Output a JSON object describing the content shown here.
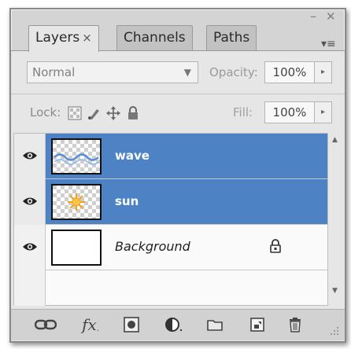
{
  "window": {
    "collapse_glyph": "–",
    "close_glyph": "✕"
  },
  "tabs": [
    {
      "label": "Layers",
      "close_glyph": "×",
      "active": true
    },
    {
      "label": "Channels",
      "active": false
    },
    {
      "label": "Paths",
      "active": false
    }
  ],
  "panel_menu_glyph": "▾≡",
  "blend": {
    "mode": "Normal",
    "arrow": "▼"
  },
  "opacity": {
    "label": "Opacity:",
    "value": "100%",
    "spin": "▸"
  },
  "lock": {
    "label": "Lock:",
    "icons": [
      "lock-transparent-pixels-icon",
      "lock-image-pixels-icon",
      "lock-position-icon",
      "lock-all-icon"
    ]
  },
  "fill": {
    "label": "Fill:",
    "value": "100%",
    "spin": "▸"
  },
  "layers": [
    {
      "name": "wave",
      "selected": true,
      "visible": true,
      "thumbnail": "wave-thumbnail"
    },
    {
      "name": "sun",
      "selected": true,
      "visible": true,
      "thumbnail": "sun-thumbnail"
    },
    {
      "name": "Background",
      "selected": false,
      "visible": true,
      "locked": true,
      "thumbnail": "white-thumbnail"
    }
  ],
  "toolbar": {
    "fx_label": "fx",
    "icons": [
      "link-layers-icon",
      "layer-style-fx-icon",
      "add-mask-icon",
      "adjustment-layer-icon",
      "new-group-icon",
      "new-layer-icon",
      "delete-layer-icon"
    ]
  },
  "colors": {
    "selection": "#4d82c4",
    "panel": "#e6e6e6",
    "sun": "#f2a51a",
    "wave": "#5b8fd6"
  }
}
